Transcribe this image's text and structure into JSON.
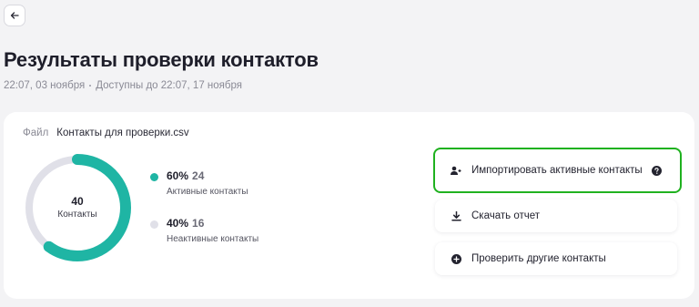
{
  "page": {
    "title": "Результаты проверки контактов",
    "created": "22:07, 03 ноября",
    "available_until": "Доступны до 22:07, 17 ноября"
  },
  "file": {
    "label": "Файл",
    "name": "Контакты для проверки.csv"
  },
  "summary": {
    "total": "40",
    "total_caption": "Контакты",
    "active": {
      "percent": "60%",
      "count": "24",
      "label": "Активные контакты",
      "fraction": 0.6,
      "color": "#1fb5a4"
    },
    "inactive": {
      "percent": "40%",
      "count": "16",
      "label": "Неактивные контакты",
      "fraction": 0.4,
      "color": "#e0e0e8"
    }
  },
  "actions": {
    "import_label": "Импортировать активные контакты",
    "download_label": "Скачать отчет",
    "check_other_label": "Проверить другие контакты"
  },
  "icons": {
    "back": "arrow-left-icon",
    "import": "add-user-icon",
    "help": "help-circle-icon",
    "download": "download-icon",
    "add": "plus-circle-icon"
  }
}
